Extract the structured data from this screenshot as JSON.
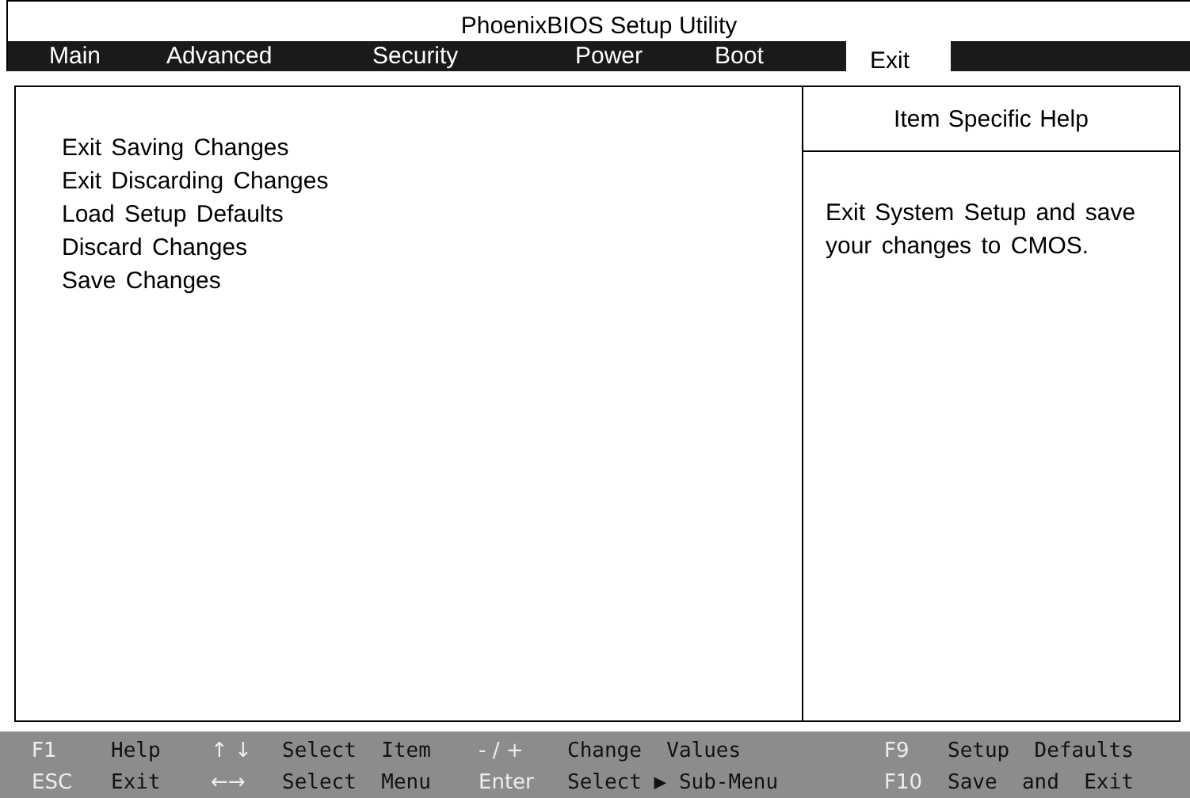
{
  "window": {
    "title": "PhoenixBIOS Setup Utility"
  },
  "tabs": [
    {
      "label": "Main",
      "selected": false
    },
    {
      "label": "Advanced",
      "selected": false
    },
    {
      "label": "Security",
      "selected": false
    },
    {
      "label": "Power",
      "selected": false
    },
    {
      "label": "Boot",
      "selected": false
    },
    {
      "label": "Exit",
      "selected": true
    }
  ],
  "menu_items": [
    "Exit Saving Changes",
    "Exit Discarding Changes",
    "Load Setup Defaults",
    "Discard Changes",
    "Save Changes"
  ],
  "help": {
    "title": "Item Specific Help",
    "text": "Exit System Setup and save your changes to CMOS."
  },
  "footer": [
    [
      {
        "key": "F1",
        "action": "Help"
      },
      {
        "key": "↑ ↓",
        "action": "Select  Item"
      },
      {
        "key": "- / +",
        "action": "Change  Values"
      },
      {
        "key": "F9",
        "action": "Setup  Defaults"
      }
    ],
    [
      {
        "key": "ESC",
        "action": "Exit"
      },
      {
        "key": "←→",
        "action": "Select  Menu"
      },
      {
        "key": "Enter",
        "action": "Select ▶ Sub-Menu"
      },
      {
        "key": "F10",
        "action": "Save  and  Exit"
      }
    ]
  ]
}
